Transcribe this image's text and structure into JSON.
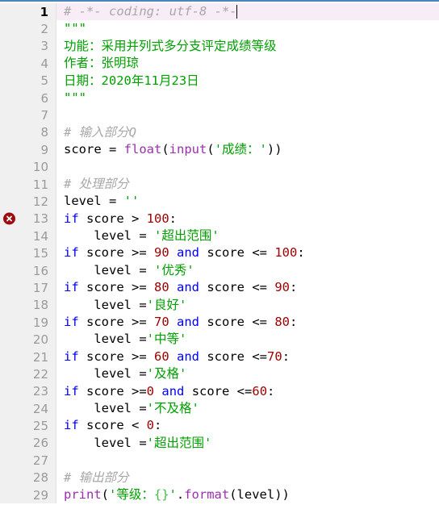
{
  "editor": {
    "title": "python-code-editor",
    "language": "Python",
    "colors": {
      "background": "#ffffff",
      "gutter_background": "#f0f0f0",
      "gutter_text": "#9a9a9a",
      "current_line_highlight": "#f8ecf7",
      "top_border": "#4a86b8",
      "comment": "#a8a8a8",
      "string": "#00a000",
      "keyword": "#0000ff",
      "function": "#9b2fae",
      "number": "#a00000",
      "error_marker": "#9e0b0f"
    },
    "error_marker_icon": "error-cross-icon",
    "error_line": 13,
    "current_line": 1,
    "caret_line": 1
  },
  "lines": [
    {
      "num": "1",
      "current": true,
      "error": false,
      "caret_after": 2,
      "tokens": [
        {
          "t": "comment",
          "v": "# -*- coding"
        },
        {
          "t": "comment",
          "v": ": utf-8 -*-"
        }
      ]
    },
    {
      "num": "2",
      "current": false,
      "error": false,
      "tokens": [
        {
          "t": "string",
          "v": "\"\"\""
        }
      ]
    },
    {
      "num": "3",
      "current": false,
      "error": false,
      "tokens": [
        {
          "t": "string",
          "v": "功能：采用并列式多分支评定成绩等级"
        }
      ]
    },
    {
      "num": "4",
      "current": false,
      "error": false,
      "tokens": [
        {
          "t": "string",
          "v": "作者：张明琼"
        }
      ]
    },
    {
      "num": "5",
      "current": false,
      "error": false,
      "tokens": [
        {
          "t": "string",
          "v": "日期：2020年11月23日"
        }
      ]
    },
    {
      "num": "6",
      "current": false,
      "error": false,
      "tokens": [
        {
          "t": "string",
          "v": "\"\"\""
        }
      ]
    },
    {
      "num": "7",
      "current": false,
      "error": false,
      "tokens": []
    },
    {
      "num": "8",
      "current": false,
      "error": false,
      "tokens": [
        {
          "t": "comment",
          "v": "# 输入部分Q"
        }
      ]
    },
    {
      "num": "9",
      "current": false,
      "error": false,
      "tokens": [
        {
          "t": "plain",
          "v": "score = "
        },
        {
          "t": "fn",
          "v": "float"
        },
        {
          "t": "plain",
          "v": "("
        },
        {
          "t": "fn",
          "v": "input"
        },
        {
          "t": "plain",
          "v": "("
        },
        {
          "t": "string",
          "v": "'成绩："
        },
        {
          "t": "string",
          "v": "'"
        },
        {
          "t": "plain",
          "v": "))"
        }
      ]
    },
    {
      "num": "10",
      "current": false,
      "error": false,
      "tokens": []
    },
    {
      "num": "11",
      "current": false,
      "error": false,
      "tokens": [
        {
          "t": "comment",
          "v": "# 处理部分"
        }
      ]
    },
    {
      "num": "12",
      "current": false,
      "error": false,
      "tokens": [
        {
          "t": "plain",
          "v": "level = "
        },
        {
          "t": "string",
          "v": "''"
        }
      ]
    },
    {
      "num": "13",
      "current": false,
      "error": true,
      "tokens": [
        {
          "t": "kw",
          "v": "if"
        },
        {
          "t": "plain",
          "v": " score > "
        },
        {
          "t": "num",
          "v": "100"
        },
        {
          "t": "plain",
          "v": ":"
        }
      ]
    },
    {
      "num": "14",
      "current": false,
      "error": false,
      "tokens": [
        {
          "t": "plain",
          "v": "    level = "
        },
        {
          "t": "string",
          "v": "'超出范围'"
        }
      ]
    },
    {
      "num": "15",
      "current": false,
      "error": false,
      "tokens": [
        {
          "t": "kw",
          "v": "if"
        },
        {
          "t": "plain",
          "v": " score >= "
        },
        {
          "t": "num",
          "v": "90"
        },
        {
          "t": "plain",
          "v": " "
        },
        {
          "t": "kw",
          "v": "and"
        },
        {
          "t": "plain",
          "v": " score <= "
        },
        {
          "t": "num",
          "v": "100"
        },
        {
          "t": "plain",
          "v": ":"
        }
      ]
    },
    {
      "num": "16",
      "current": false,
      "error": false,
      "tokens": [
        {
          "t": "plain",
          "v": "    level = "
        },
        {
          "t": "string",
          "v": "'优秀'"
        }
      ]
    },
    {
      "num": "17",
      "current": false,
      "error": false,
      "tokens": [
        {
          "t": "kw",
          "v": "if"
        },
        {
          "t": "plain",
          "v": " score >= "
        },
        {
          "t": "num",
          "v": "80"
        },
        {
          "t": "plain",
          "v": " "
        },
        {
          "t": "kw",
          "v": "and"
        },
        {
          "t": "plain",
          "v": " score <= "
        },
        {
          "t": "num",
          "v": "90"
        },
        {
          "t": "plain",
          "v": ":"
        }
      ]
    },
    {
      "num": "18",
      "current": false,
      "error": false,
      "tokens": [
        {
          "t": "plain",
          "v": "    level ="
        },
        {
          "t": "string",
          "v": "'良好'"
        }
      ]
    },
    {
      "num": "19",
      "current": false,
      "error": false,
      "tokens": [
        {
          "t": "kw",
          "v": "if"
        },
        {
          "t": "plain",
          "v": " score >= "
        },
        {
          "t": "num",
          "v": "70"
        },
        {
          "t": "plain",
          "v": " "
        },
        {
          "t": "kw",
          "v": "and"
        },
        {
          "t": "plain",
          "v": " score <= "
        },
        {
          "t": "num",
          "v": "80"
        },
        {
          "t": "plain",
          "v": ":"
        }
      ]
    },
    {
      "num": "20",
      "current": false,
      "error": false,
      "tokens": [
        {
          "t": "plain",
          "v": "    level ="
        },
        {
          "t": "string",
          "v": "'中等'"
        }
      ]
    },
    {
      "num": "21",
      "current": false,
      "error": false,
      "tokens": [
        {
          "t": "kw",
          "v": "if"
        },
        {
          "t": "plain",
          "v": " score >= "
        },
        {
          "t": "num",
          "v": "60"
        },
        {
          "t": "plain",
          "v": " "
        },
        {
          "t": "kw",
          "v": "and"
        },
        {
          "t": "plain",
          "v": " score <="
        },
        {
          "t": "num",
          "v": "70"
        },
        {
          "t": "plain",
          "v": ":"
        }
      ]
    },
    {
      "num": "22",
      "current": false,
      "error": false,
      "tokens": [
        {
          "t": "plain",
          "v": "    level ="
        },
        {
          "t": "string",
          "v": "'及格'"
        }
      ]
    },
    {
      "num": "23",
      "current": false,
      "error": false,
      "tokens": [
        {
          "t": "kw",
          "v": "if"
        },
        {
          "t": "plain",
          "v": " score >="
        },
        {
          "t": "num",
          "v": "0"
        },
        {
          "t": "plain",
          "v": " "
        },
        {
          "t": "kw",
          "v": "and"
        },
        {
          "t": "plain",
          "v": " score <="
        },
        {
          "t": "num",
          "v": "60"
        },
        {
          "t": "plain",
          "v": ":"
        }
      ]
    },
    {
      "num": "24",
      "current": false,
      "error": false,
      "tokens": [
        {
          "t": "plain",
          "v": "    level ="
        },
        {
          "t": "string",
          "v": "'不及格'"
        }
      ]
    },
    {
      "num": "25",
      "current": false,
      "error": false,
      "tokens": [
        {
          "t": "kw",
          "v": "if"
        },
        {
          "t": "plain",
          "v": " score < "
        },
        {
          "t": "num",
          "v": "0"
        },
        {
          "t": "plain",
          "v": ":"
        }
      ]
    },
    {
      "num": "26",
      "current": false,
      "error": false,
      "tokens": [
        {
          "t": "plain",
          "v": "    level ="
        },
        {
          "t": "string",
          "v": "'超出范围'"
        }
      ]
    },
    {
      "num": "27",
      "current": false,
      "error": false,
      "tokens": []
    },
    {
      "num": "28",
      "current": false,
      "error": false,
      "tokens": [
        {
          "t": "comment",
          "v": "# 输出部分"
        }
      ]
    },
    {
      "num": "29",
      "current": false,
      "error": false,
      "tokens": [
        {
          "t": "fn",
          "v": "print"
        },
        {
          "t": "plain",
          "v": "("
        },
        {
          "t": "string",
          "v": "'等级："
        },
        {
          "t": "brace",
          "v": "{}"
        },
        {
          "t": "string",
          "v": "'"
        },
        {
          "t": "plain",
          "v": "."
        },
        {
          "t": "fn",
          "v": "format"
        },
        {
          "t": "plain",
          "v": "(level))"
        }
      ]
    }
  ]
}
